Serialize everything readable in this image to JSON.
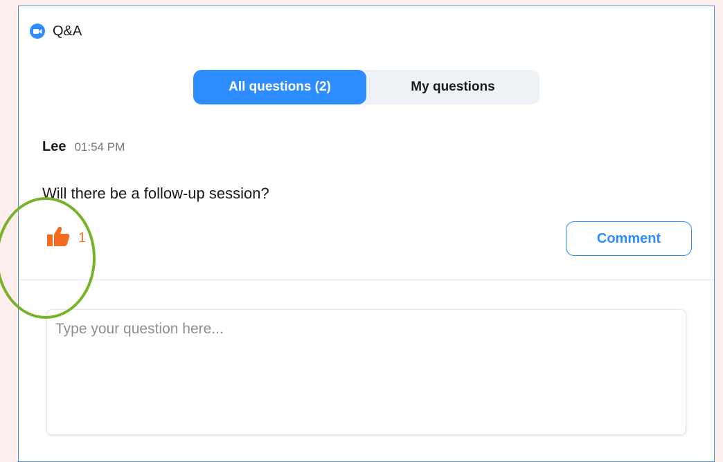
{
  "window": {
    "title": "Q&A",
    "app_icon": "zoom-camera-icon",
    "accent_color": "#2d8cff"
  },
  "tabs": [
    {
      "label": "All questions (2)",
      "active": true
    },
    {
      "label": "My questions",
      "active": false
    }
  ],
  "question": {
    "author": "Lee",
    "time": "01:54 PM",
    "text": "Will there be a follow-up session?",
    "upvote_icon": "thumbs-up-icon",
    "upvote_count": "1",
    "upvote_color": "#f26d21",
    "comment_label": "Comment"
  },
  "composer": {
    "placeholder": "Type your question here..."
  },
  "annotation": {
    "highlight_color": "#78b22a"
  }
}
